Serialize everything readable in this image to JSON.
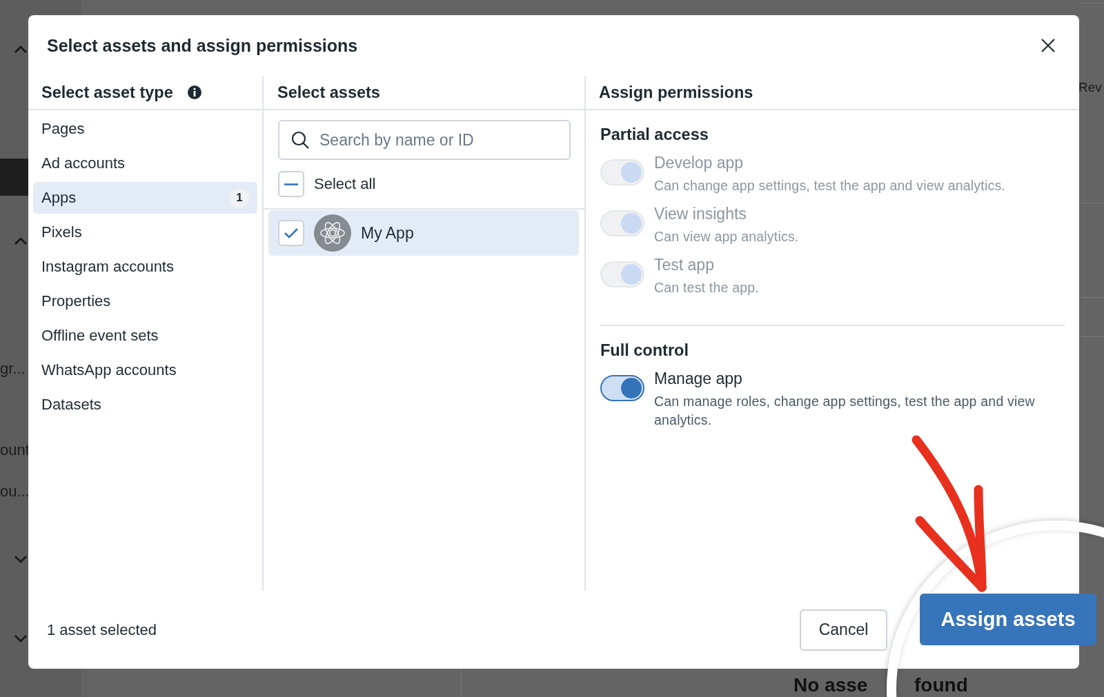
{
  "background": {
    "side_texts": [
      {
        "text": "gr..."
      },
      {
        "text": "ount"
      },
      {
        "text": "ou..."
      }
    ],
    "right_label": "Rev",
    "empty_message_parts": [
      "No asse",
      "found"
    ]
  },
  "dialog": {
    "title": "Select assets and assign permissions",
    "asset_types": {
      "heading": "Select asset type",
      "items": [
        {
          "label": "Pages",
          "selected": false
        },
        {
          "label": "Ad accounts",
          "selected": false
        },
        {
          "label": "Apps",
          "count": "1",
          "selected": true
        },
        {
          "label": "Pixels",
          "selected": false
        },
        {
          "label": "Instagram accounts",
          "selected": false
        },
        {
          "label": "Properties",
          "selected": false
        },
        {
          "label": "Offline event sets",
          "selected": false
        },
        {
          "label": "WhatsApp accounts",
          "selected": false
        },
        {
          "label": "Datasets",
          "selected": false
        }
      ]
    },
    "assets": {
      "heading": "Select assets",
      "search": {
        "placeholder": "Search by name or ID"
      },
      "select_all": {
        "label": "Select all",
        "indeterminate": true
      },
      "items": [
        {
          "name": "My App",
          "checked": true,
          "selected": true
        }
      ]
    },
    "permissions": {
      "heading": "Assign permissions",
      "groups": [
        {
          "title": "Partial access",
          "items": [
            {
              "name": "Develop app",
              "description": "Can change app settings, test the app and view analytics.",
              "on": true,
              "disabled": true
            },
            {
              "name": "View insights",
              "description": "Can view app analytics.",
              "on": true,
              "disabled": true
            },
            {
              "name": "Test app",
              "description": "Can test the app.",
              "on": true,
              "disabled": true
            }
          ]
        },
        {
          "title": "Full control",
          "items": [
            {
              "name": "Manage app",
              "description": "Can manage roles, change app settings, test the app and view analytics.",
              "on": true,
              "disabled": false
            }
          ]
        }
      ]
    },
    "footer": {
      "summary": "1 asset selected",
      "buttons": [
        {
          "label": "Cancel",
          "kind": "secondary"
        },
        {
          "label": "Assign assets",
          "kind": "primary"
        }
      ]
    }
  }
}
